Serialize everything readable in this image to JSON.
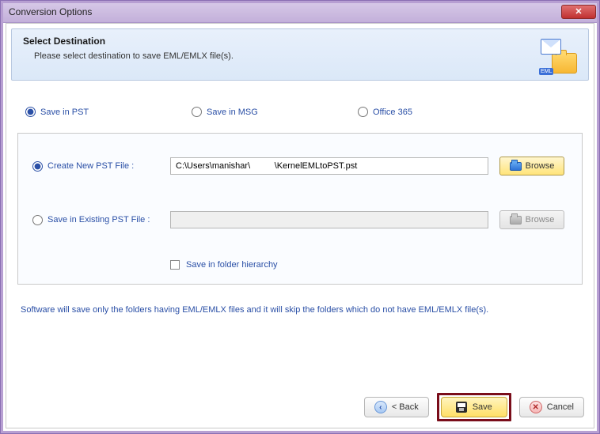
{
  "window": {
    "title": "Conversion Options"
  },
  "header": {
    "title": "Select Destination",
    "subtitle": "Please select destination to save EML/EMLX file(s)."
  },
  "topRadios": {
    "pst": "Save in PST",
    "msg": "Save in MSG",
    "o365": "Office 365"
  },
  "pstOptions": {
    "createNew": {
      "label": "Create New PST File :",
      "path": "C:\\Users\\manishar\\          \\KernelEMLtoPST.pst",
      "browse": "Browse"
    },
    "existing": {
      "label": "Save in Existing PST File :",
      "path": "",
      "browse": "Browse"
    },
    "hierarchy": "Save in folder hierarchy"
  },
  "note": "Software will save only the folders having EML/EMLX files and it will skip the folders which do not have EML/EMLX file(s).",
  "footer": {
    "back": "< Back",
    "save": "Save",
    "cancel": "Cancel"
  }
}
